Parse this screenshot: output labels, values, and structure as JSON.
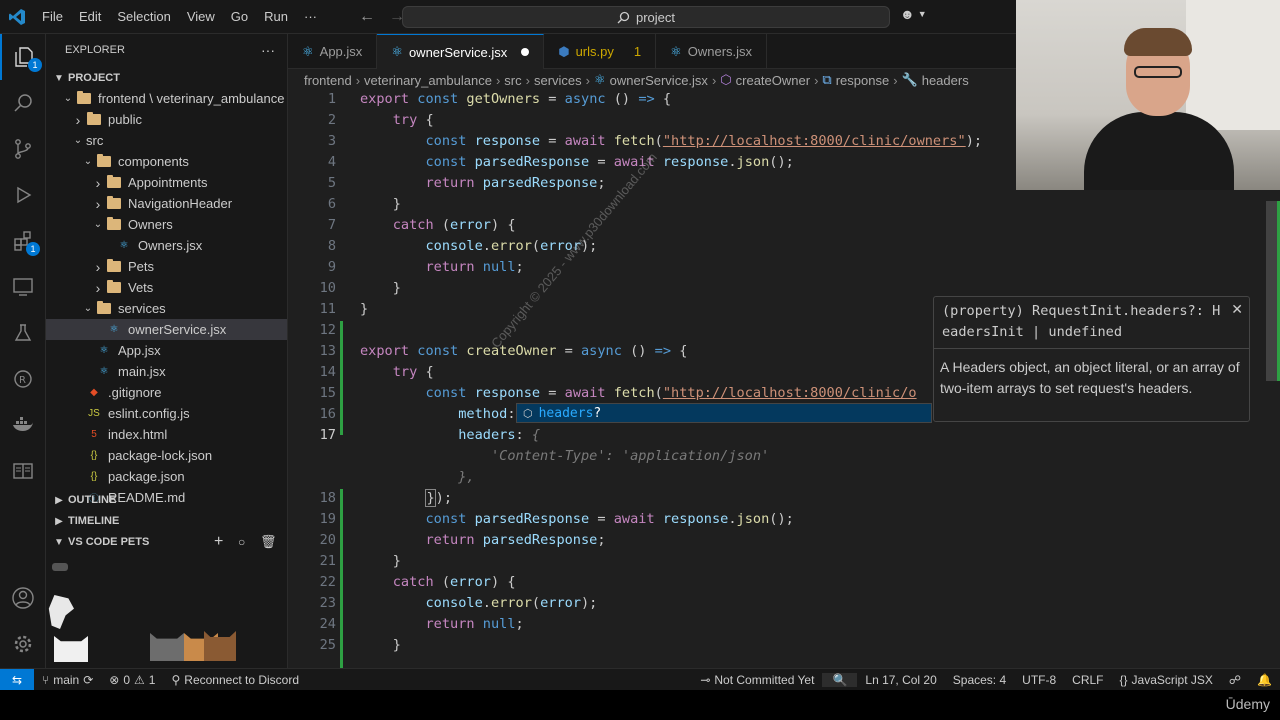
{
  "titlebar": {
    "menu": [
      "File",
      "Edit",
      "Selection",
      "View",
      "Go",
      "Run",
      "···"
    ],
    "search": "project"
  },
  "sidebar": {
    "title": "EXPLORER",
    "project": "PROJECT",
    "tree": [
      {
        "label": "frontend \\ veterinary_ambulance",
        "depth": 1,
        "kind": "folder",
        "open": true
      },
      {
        "label": "public",
        "depth": 2,
        "kind": "folder",
        "open": false
      },
      {
        "label": "src",
        "depth": 2,
        "kind": "plain",
        "open": true
      },
      {
        "label": "components",
        "depth": 3,
        "kind": "folder",
        "open": true
      },
      {
        "label": "Appointments",
        "depth": 4,
        "kind": "folder",
        "open": false
      },
      {
        "label": "NavigationHeader",
        "depth": 4,
        "kind": "folder",
        "open": false
      },
      {
        "label": "Owners",
        "depth": 4,
        "kind": "folder",
        "open": true
      },
      {
        "label": "Owners.jsx",
        "depth": 5,
        "kind": "react"
      },
      {
        "label": "Pets",
        "depth": 4,
        "kind": "folder",
        "open": false
      },
      {
        "label": "Vets",
        "depth": 4,
        "kind": "folder",
        "open": false
      },
      {
        "label": "services",
        "depth": 3,
        "kind": "folder",
        "open": true
      },
      {
        "label": "ownerService.jsx",
        "depth": 4,
        "kind": "react",
        "selected": true
      },
      {
        "label": "App.jsx",
        "depth": 3,
        "kind": "react"
      },
      {
        "label": "main.jsx",
        "depth": 3,
        "kind": "react"
      },
      {
        "label": ".gitignore",
        "depth": 2,
        "kind": "git"
      },
      {
        "label": "eslint.config.js",
        "depth": 2,
        "kind": "js"
      },
      {
        "label": "index.html",
        "depth": 2,
        "kind": "html"
      },
      {
        "label": "package-lock.json",
        "depth": 2,
        "kind": "json"
      },
      {
        "label": "package.json",
        "depth": 2,
        "kind": "json"
      },
      {
        "label": "README.md",
        "depth": 2,
        "kind": "md"
      }
    ],
    "sections": [
      "OUTLINE",
      "TIMELINE",
      "VS CODE PETS"
    ]
  },
  "tabs": [
    {
      "label": "App.jsx",
      "kind": "react"
    },
    {
      "label": "ownerService.jsx",
      "kind": "react",
      "active": true,
      "dirty": true
    },
    {
      "label": "urls.py",
      "kind": "py",
      "problems": "1"
    },
    {
      "label": "Owners.jsx",
      "kind": "react"
    }
  ],
  "breadcrumb": [
    "frontend",
    "veterinary_ambulance",
    "src",
    "services",
    "ownerService.jsx",
    "createOwner",
    "response",
    "headers"
  ],
  "editor": {
    "line_numbers": [
      "1",
      "2",
      "3",
      "4",
      "5",
      "6",
      "7",
      "8",
      "9",
      "10",
      "11",
      "12",
      "13",
      "14",
      "15",
      "16",
      "17",
      "",
      "",
      "18",
      "19",
      "20",
      "21",
      "22",
      "23",
      "24",
      "25"
    ],
    "url": "\"http://localhost:8000/clinic/owners\"",
    "url_partial": "\"http://localhost:8000/clinic/o",
    "ghost_content_type": "'Content-Type': 'application/json'",
    "watermark": "Copyright © 2025 - www.p30download.com"
  },
  "suggest": {
    "label": "headers",
    "suffix": "?"
  },
  "hover": {
    "signature_line1": "(property) RequestInit.headers?: H",
    "signature_line2": "eadersInit | undefined",
    "doc": "A Headers object, an object literal, or an array of two-item arrays to set request's headers."
  },
  "statusbar": {
    "branch": "main",
    "errors": "0",
    "warnings": "1",
    "discord": "Reconnect to Discord",
    "git_status": "Not Committed Yet",
    "position": "Ln 17, Col 20",
    "spaces": "Spaces: 4",
    "encoding": "UTF-8",
    "eol": "CRLF",
    "language": "JavaScript JSX"
  },
  "brand": "Ūdemy",
  "colors": {
    "accent": "#0078d4",
    "modified_gutter": "#2ea043",
    "keyword": "#c586c0",
    "storage": "#569cd6",
    "function": "#dcdcaa",
    "variable": "#9cdcfe",
    "string": "#ce9178"
  }
}
